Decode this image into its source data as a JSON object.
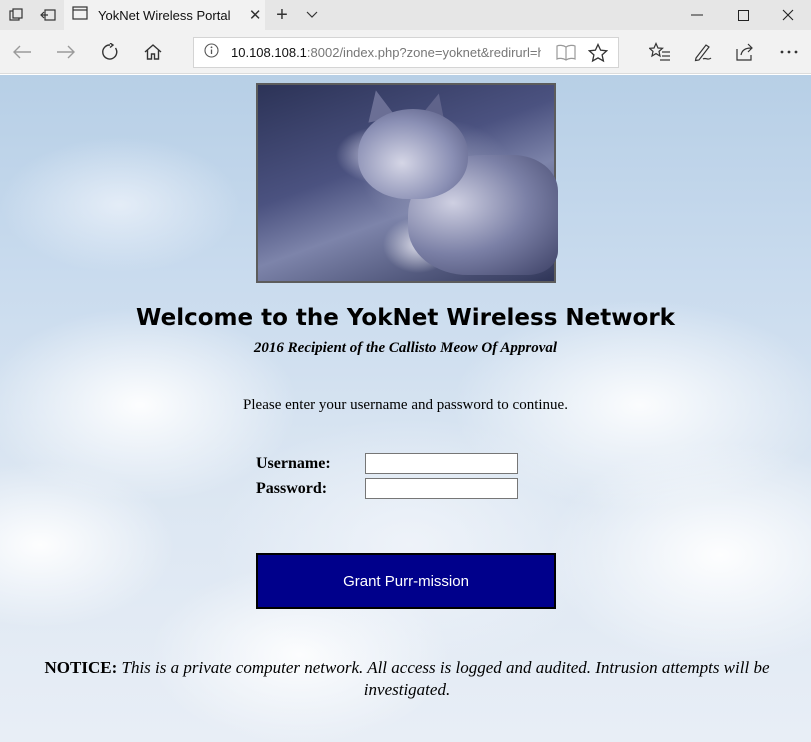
{
  "browser": {
    "tab_title": "YokNet Wireless Portal",
    "url_host": "10.108.108.1",
    "url_rest": ":8002/index.php?zone=yoknet&redirurl=ht"
  },
  "page": {
    "welcome": "Welcome to the YokNet Wireless Network",
    "subtitle": "2016 Recipient of the Callisto Meow Of Approval",
    "prompt": "Please enter your username and password to continue.",
    "username_label": "Username:",
    "password_label": "Password:",
    "username_value": "",
    "password_value": "",
    "grant_button": "Grant Purr-mission",
    "notice_label": "NOTICE:",
    "notice_text": "This is a private computer network. All access is logged and audited. Intrusion attempts will be investigated."
  },
  "colors": {
    "button_bg": "#00008b",
    "button_text": "#ffffff"
  },
  "icons": {
    "tab_list": "tab-list-icon",
    "set_aside": "set-aside-tabs-icon",
    "tab_favicon": "page-icon",
    "tab_close": "close-icon",
    "new_tab": "plus-icon",
    "tab_menu": "chevron-down-icon",
    "minimize": "minimize-icon",
    "maximize": "maximize-icon",
    "close_window": "close-icon",
    "back": "back-arrow-icon",
    "forward": "forward-arrow-icon",
    "refresh": "refresh-icon",
    "home": "home-icon",
    "info": "info-icon",
    "reading_view": "book-icon",
    "favorite": "star-icon",
    "favorites_hub": "favorites-list-icon",
    "notes": "pen-icon",
    "share": "share-icon",
    "more": "more-icon"
  }
}
